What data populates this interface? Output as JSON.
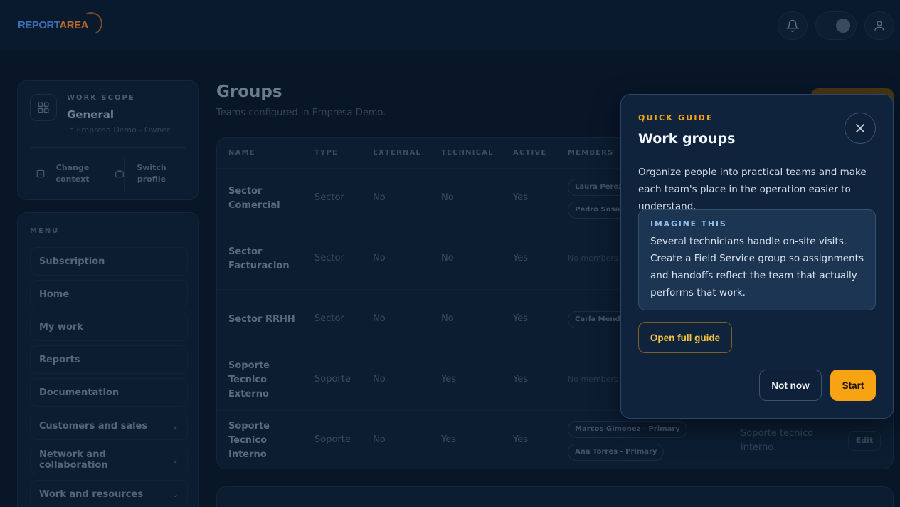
{
  "header": {
    "logo_part1": "REPORT",
    "logo_part2": "AREA",
    "icons": [
      "bell-icon",
      "theme-toggle",
      "user-icon"
    ]
  },
  "scope": {
    "kicker": "WORK SCOPE",
    "title": "General",
    "subtitle": "in Empresa Demo - Owner",
    "change_context": "Change context",
    "switch_profile": "Switch profile"
  },
  "menu": {
    "label": "MENU",
    "items": [
      {
        "label": "Subscription",
        "expandable": false
      },
      {
        "label": "Home",
        "expandable": false
      },
      {
        "label": "My work",
        "expandable": false
      },
      {
        "label": "Reports",
        "expandable": false
      },
      {
        "label": "Documentation",
        "expandable": false
      },
      {
        "label": "Customers and sales",
        "expandable": true
      },
      {
        "label": "Network and collaboration",
        "expandable": true
      },
      {
        "label": "Work and resources",
        "expandable": true
      }
    ]
  },
  "main": {
    "title": "Groups",
    "subtitle": "Teams configured in Empresa Demo."
  },
  "table": {
    "headers": [
      "NAME",
      "TYPE",
      "EXTERNAL",
      "TECHNICAL",
      "ACTIVE",
      "MEMBERS"
    ],
    "no_members": "No members",
    "edit_label": "Edit",
    "rows": [
      {
        "name": "Sector Comercial",
        "type": "Sector",
        "external": "No",
        "technical": "No",
        "active": "Yes",
        "members": [
          "Laura Perez",
          "Pedro Sosa"
        ],
        "description": ""
      },
      {
        "name": "Sector Facturacion",
        "type": "Sector",
        "external": "No",
        "technical": "No",
        "active": "Yes",
        "members": [],
        "description": ""
      },
      {
        "name": "Sector RRHH",
        "type": "Sector",
        "external": "No",
        "technical": "No",
        "active": "Yes",
        "members": [
          "Carla Mende"
        ],
        "description": ""
      },
      {
        "name": "Soporte Tecnico Externo",
        "type": "Soporte",
        "external": "No",
        "technical": "Yes",
        "active": "Yes",
        "members": [],
        "description": ""
      },
      {
        "name": "Soporte Tecnico Interno",
        "type": "Soporte",
        "external": "No",
        "technical": "Yes",
        "active": "Yes",
        "members": [
          "Marcos Gimenez - Primary",
          "Ana Torres - Primary"
        ],
        "description": "Soporte tecnico interno."
      }
    ]
  },
  "guide": {
    "kicker": "QUICK GUIDE",
    "title": "Work groups",
    "body": "Organize people into practical teams and make each team's place in the operation easier to understand.",
    "imagine_kicker": "IMAGINE THIS",
    "imagine_text": "Several technicians handle on-site visits. Create a Field Service group so assignments and handoffs reflect the team that actually performs that work.",
    "open_full_guide": "Open full guide",
    "not_now": "Not now",
    "start": "Start"
  },
  "colors": {
    "accent": "#f8a412",
    "background": "#081628",
    "popover": "#10233d"
  }
}
